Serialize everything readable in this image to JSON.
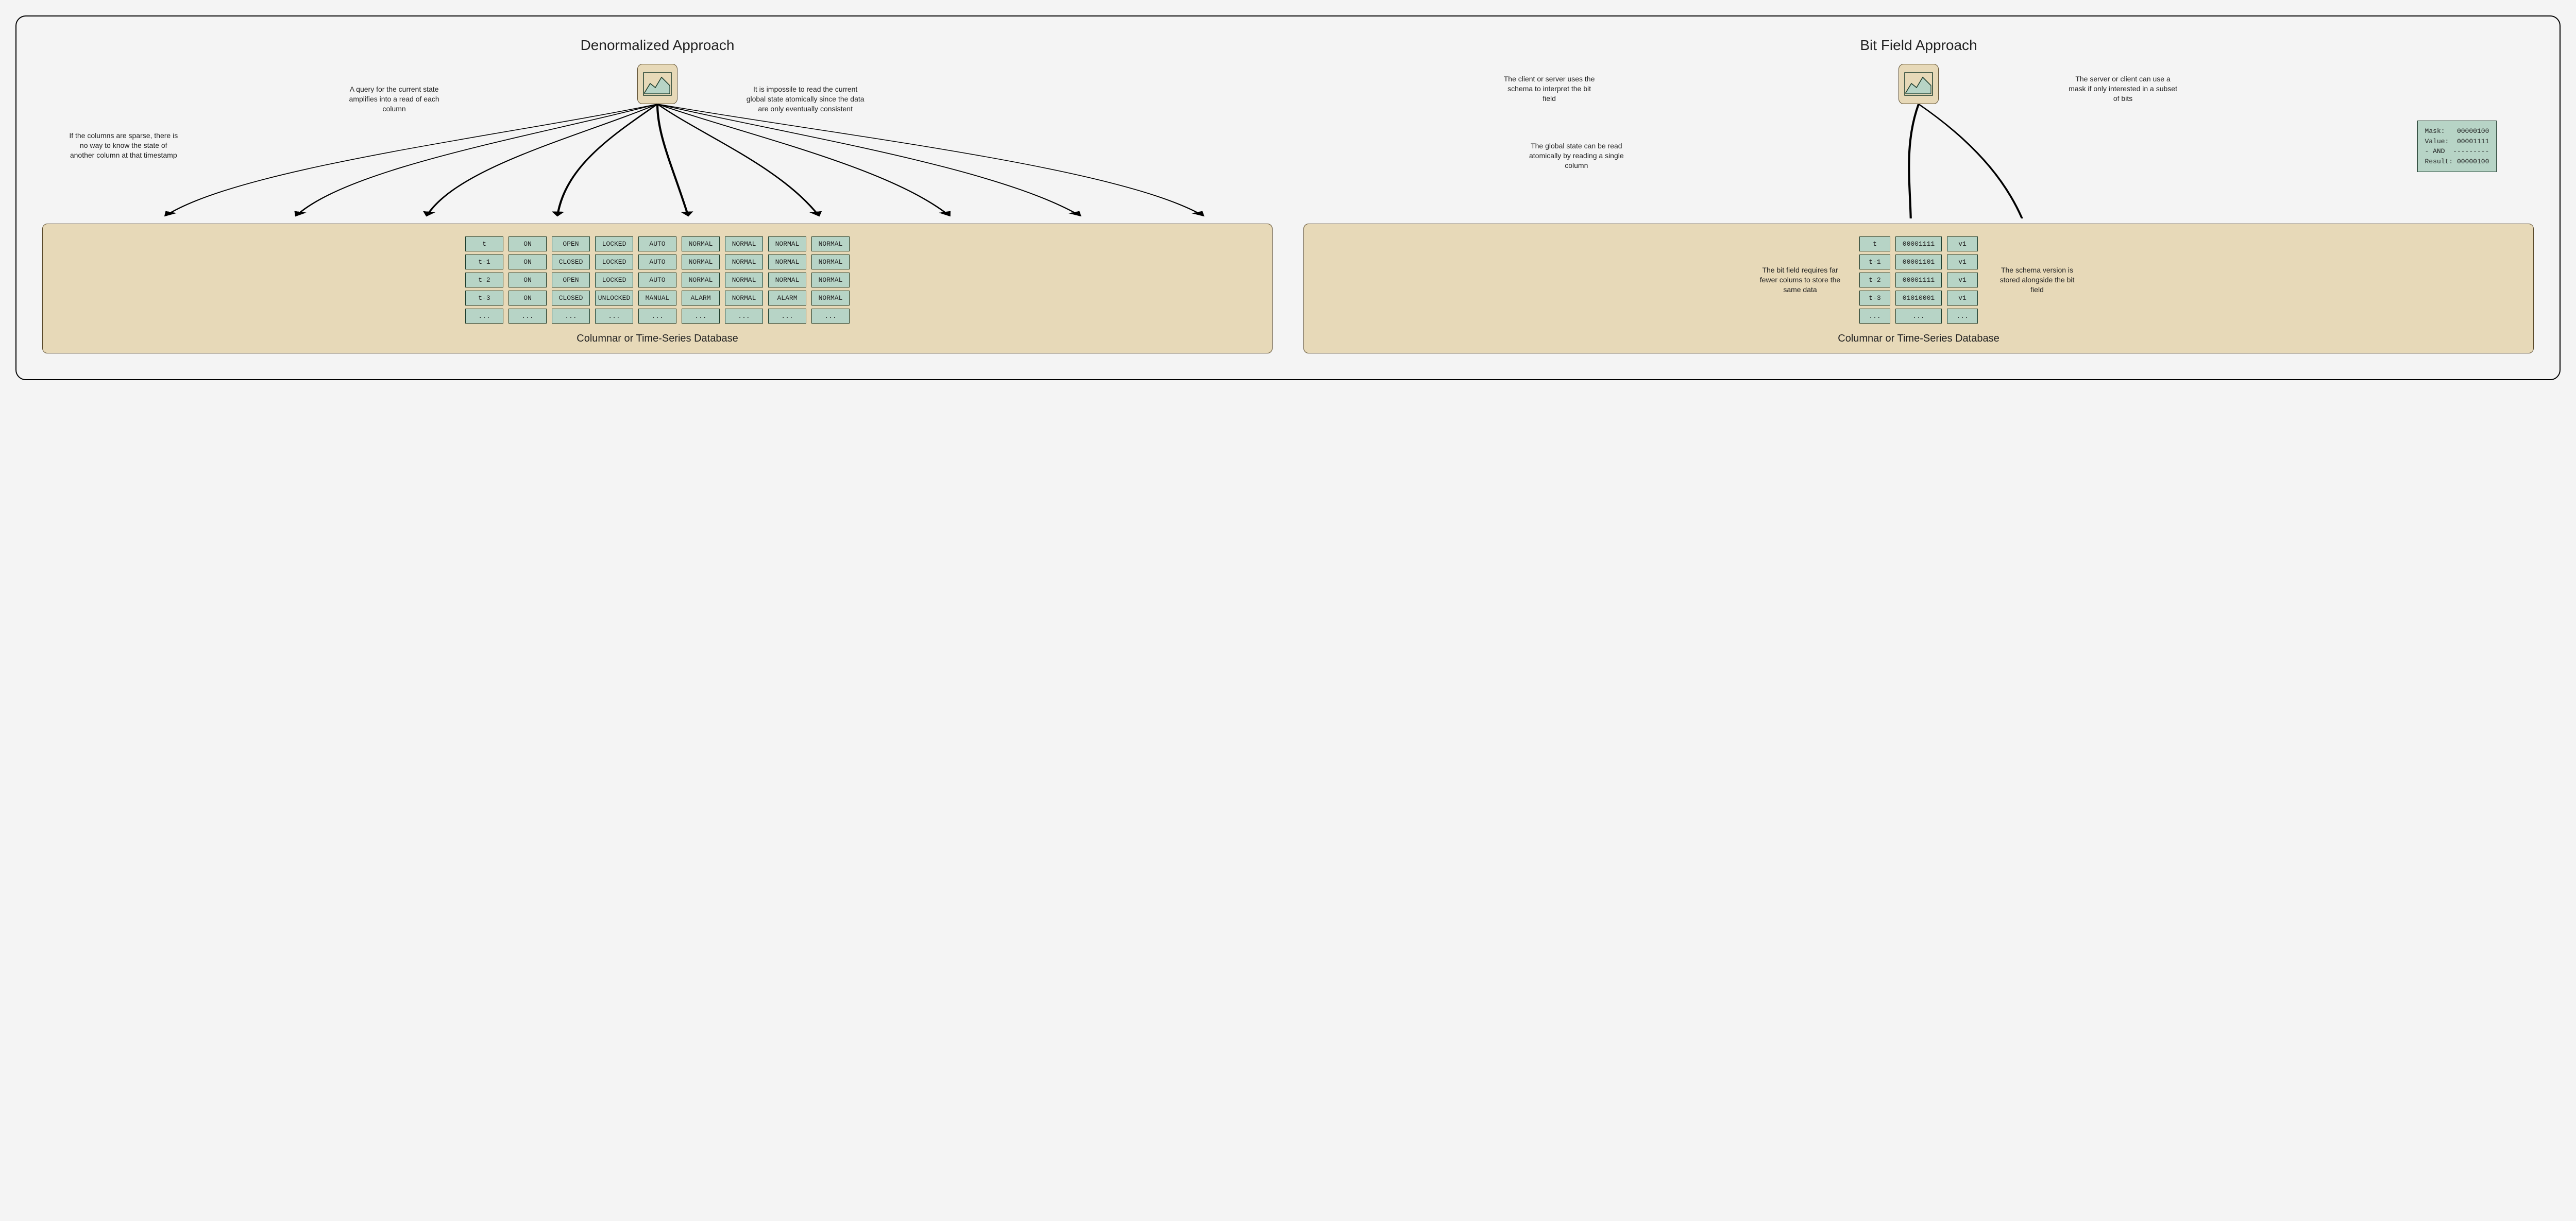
{
  "left": {
    "title": "Denormalized Approach",
    "note_query": "A query for the current state amplifies into a read of each column",
    "note_impossible": "It is impossile to read the current global state atomically since the data are only eventually consistent",
    "note_sparse": "If the columns are sparse, there is no way to know the state of another column at that timestamp",
    "db_caption": "Columnar or Time-Series Database",
    "columns": [
      [
        "t",
        "t-1",
        "t-2",
        "t-3",
        "..."
      ],
      [
        "ON",
        "ON",
        "ON",
        "ON",
        "..."
      ],
      [
        "OPEN",
        "CLOSED",
        "OPEN",
        "CLOSED",
        "..."
      ],
      [
        "LOCKED",
        "LOCKED",
        "LOCKED",
        "UNLOCKED",
        "..."
      ],
      [
        "AUTO",
        "AUTO",
        "AUTO",
        "MANUAL",
        "..."
      ],
      [
        "NORMAL",
        "NORMAL",
        "NORMAL",
        "ALARM",
        "..."
      ],
      [
        "NORMAL",
        "NORMAL",
        "NORMAL",
        "NORMAL",
        "..."
      ],
      [
        "NORMAL",
        "NORMAL",
        "NORMAL",
        "ALARM",
        "..."
      ],
      [
        "NORMAL",
        "NORMAL",
        "NORMAL",
        "NORMAL",
        "..."
      ]
    ]
  },
  "right": {
    "title": "Bit Field Approach",
    "note_interpret": "The client or server uses the schema to interpret the bit field",
    "note_mask": "The server or client can use a mask if only interested in a subset of bits",
    "note_atomic": "The global state can be read atomically by reading a single column",
    "note_fewer": "The bit field requires far fewer colums to store the same data",
    "note_schema": "The schema version is stored alongside the bit field",
    "db_caption": "Columnar or Time-Series Database",
    "mask_lines": "Mask:   00000100\nValue:  00001111\n- AND  ---------\nResult: 00000100",
    "columns": [
      [
        "t",
        "t-1",
        "t-2",
        "t-3",
        "..."
      ],
      [
        "00001111",
        "00001101",
        "00001111",
        "01010001",
        "..."
      ],
      [
        "v1",
        "v1",
        "v1",
        "v1",
        "..."
      ]
    ]
  }
}
